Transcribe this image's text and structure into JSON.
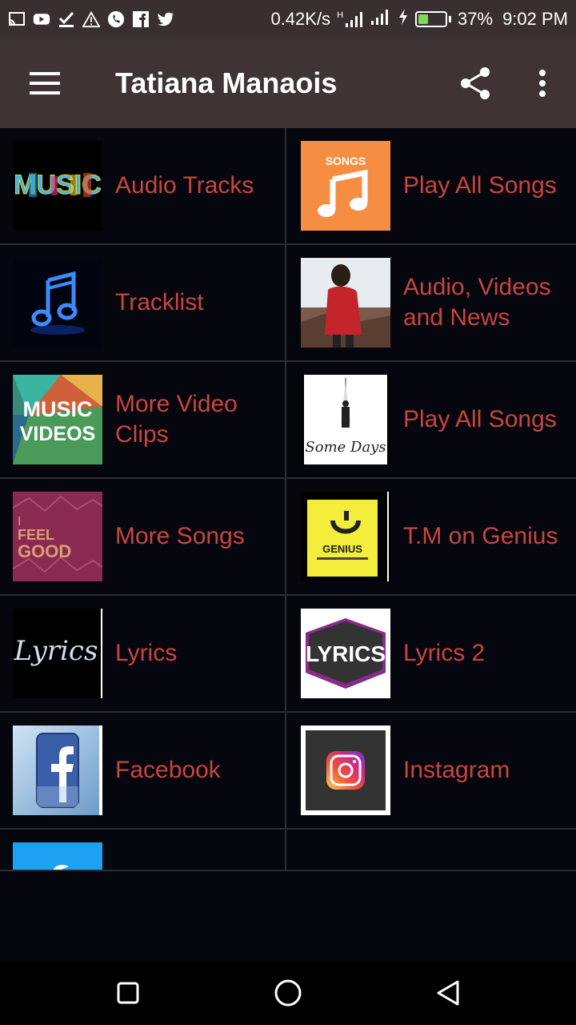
{
  "status_bar": {
    "net_speed": "0.42K/s",
    "network_type": "H",
    "battery": "37%",
    "battery_level": 0.37,
    "time": "9:02 PM",
    "left_icons": [
      "cast-icon",
      "youtube-icon",
      "download-done-icon",
      "warning-icon",
      "whatsapp-icon",
      "facebook-icon",
      "twitter-icon"
    ]
  },
  "app_bar": {
    "title": "Tatiana Manaois",
    "icons": [
      "menu-icon",
      "share-icon",
      "more-vert-icon"
    ]
  },
  "colors": {
    "label": "#c8453f",
    "app_bar": "#3f3334",
    "status_bar": "#3a2f30",
    "background": "#06060f",
    "divider": "#2b2d35"
  },
  "items": [
    {
      "label": "Audio Tracks",
      "thumb": "music-thumb"
    },
    {
      "label": "Play All Songs",
      "thumb": "songs-thumb",
      "thumb_text": "SONGS"
    },
    {
      "label": "Tracklist",
      "thumb": "blue-note-thumb"
    },
    {
      "label": "Audio, Videos and News",
      "thumb": "artist-photo-thumb"
    },
    {
      "label": "More Video Clips",
      "thumb": "music-videos-thumb"
    },
    {
      "label": "Play All Songs",
      "thumb": "some-days-thumb"
    },
    {
      "label": "More Songs",
      "thumb": "i-feel-good-thumb"
    },
    {
      "label": "T.M on Genius",
      "thumb": "genius-thumb"
    },
    {
      "label": "Lyrics",
      "thumb": "lyrics-script-thumb"
    },
    {
      "label": "Lyrics 2",
      "thumb": "lyrics-badge-thumb"
    },
    {
      "label": "Facebook",
      "thumb": "facebook-thumb"
    },
    {
      "label": "Instagram",
      "thumb": "instagram-thumb"
    }
  ],
  "nav_bar": {
    "buttons": [
      "recents-button",
      "home-button",
      "back-button"
    ]
  }
}
